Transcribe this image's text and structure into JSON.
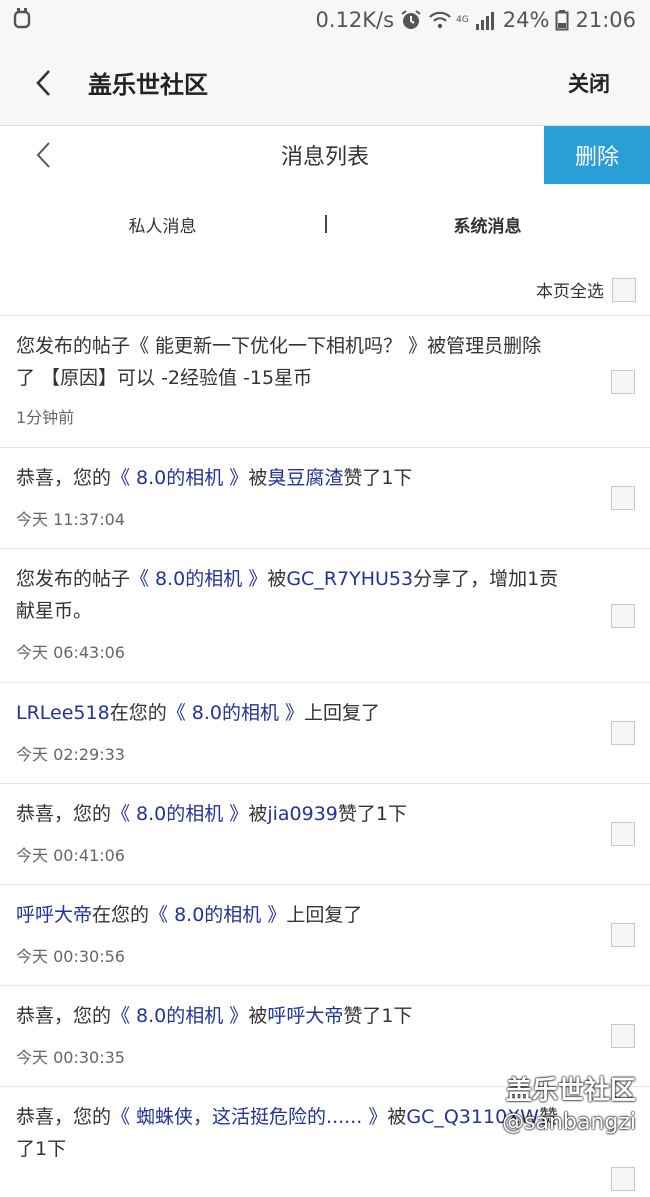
{
  "status": {
    "net_speed": "0.12K/s",
    "net_type": "4G",
    "battery": "24%",
    "time": "21:06"
  },
  "header": {
    "title": "盖乐世社区",
    "close_label": "关闭"
  },
  "subheader": {
    "title": "消息列表",
    "delete_label": "删除"
  },
  "tabs": [
    {
      "label": "私人消息"
    },
    {
      "label": "系统消息"
    }
  ],
  "select_all_label": "本页全选",
  "messages": [
    {
      "p1": "您发布的帖子《 能更新一下优化一下相机吗？ 》被管理员删除了 【原因】可以 -2经验值 -15星币",
      "time": "1分钟前"
    },
    {
      "p1": "恭喜，您的",
      "p2": "《 8.0的相机 》",
      "p3": "被",
      "p4": "臭豆腐渣",
      "p5": "赞了1下",
      "time": "今天 11:37:04"
    },
    {
      "p1": "您发布的帖子",
      "p2": "《 8.0的相机 》",
      "p3": "被",
      "p4": "GC_R7YHU53",
      "p5": "分享了，增加1贡献星币。",
      "time": "今天 06:43:06"
    },
    {
      "p1": "LRLee518",
      "p2": "在您的",
      "p3": "《 8.0的相机 》",
      "p4": "上回复了",
      "time": "今天 02:29:33"
    },
    {
      "p1": "恭喜，您的",
      "p2": "《 8.0的相机 》",
      "p3": "被",
      "p4": "jia0939",
      "p5": "赞了1下",
      "time": "今天 00:41:06"
    },
    {
      "p1": "呼呼大帝",
      "p2": "在您的",
      "p3": "《 8.0的相机 》",
      "p4": "上回复了",
      "time": "今天 00:30:56"
    },
    {
      "p1": "恭喜，您的",
      "p2": "《 8.0的相机 》",
      "p3": "被",
      "p4": "呼呼大帝",
      "p5": "赞了1下",
      "time": "今天 00:30:35"
    },
    {
      "p1": "恭喜，您的",
      "p2": "《 蜘蛛侠，这活挺危险的...... 》",
      "p3": "被",
      "p4": "GC_Q3110XW",
      "p5": "赞了1下",
      "time": ""
    }
  ],
  "watermark": {
    "line1": "盖乐世社区",
    "line2": "@sanbangzi"
  },
  "colors": {
    "accent": "#2a9ed6",
    "link": "#223399"
  },
  "icons": [
    "app-notification-icon",
    "alarm-icon",
    "wifi-icon",
    "signal-icon",
    "battery-icon",
    "back-chevron-icon",
    "checkbox-icon"
  ]
}
